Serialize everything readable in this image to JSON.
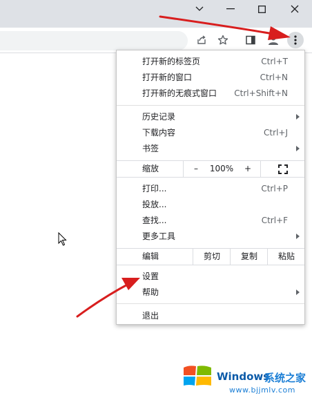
{
  "window": {
    "buttons": [
      "chevron-down-icon",
      "minimize-icon",
      "maximize-icon",
      "close-icon"
    ]
  },
  "toolbar": {
    "icons": [
      "share-icon",
      "bookmark-star-icon",
      "side-panel-icon",
      "profile-icon",
      "more-menu-icon"
    ]
  },
  "menu": {
    "new_tab": {
      "label": "打开新的标签页",
      "shortcut": "Ctrl+T"
    },
    "new_window": {
      "label": "打开新的窗口",
      "shortcut": "Ctrl+N"
    },
    "incognito": {
      "label": "打开新的无痕式窗口",
      "shortcut": "Ctrl+Shift+N"
    },
    "history": {
      "label": "历史记录"
    },
    "downloads": {
      "label": "下载内容",
      "shortcut": "Ctrl+J"
    },
    "bookmarks": {
      "label": "书签"
    },
    "zoom": {
      "label": "缩放",
      "minus": "–",
      "value": "100%",
      "plus": "+"
    },
    "print": {
      "label": "打印...",
      "shortcut": "Ctrl+P"
    },
    "cast": {
      "label": "投放..."
    },
    "find": {
      "label": "查找...",
      "shortcut": "Ctrl+F"
    },
    "more_tools": {
      "label": "更多工具"
    },
    "edit": {
      "label": "编辑",
      "cut": "剪切",
      "copy": "复制",
      "paste": "粘贴"
    },
    "settings": {
      "label": "设置"
    },
    "help": {
      "label": "帮助"
    },
    "exit": {
      "label": "退出"
    }
  },
  "watermark": {
    "brand": "Windows",
    "site_cn": "系统之家",
    "url": "www.bjjmlv.com"
  },
  "colors": {
    "annotation_arrow": "#d81e1e",
    "menu_border": "#c6c6c6",
    "titlebar": "#dee1e6"
  }
}
